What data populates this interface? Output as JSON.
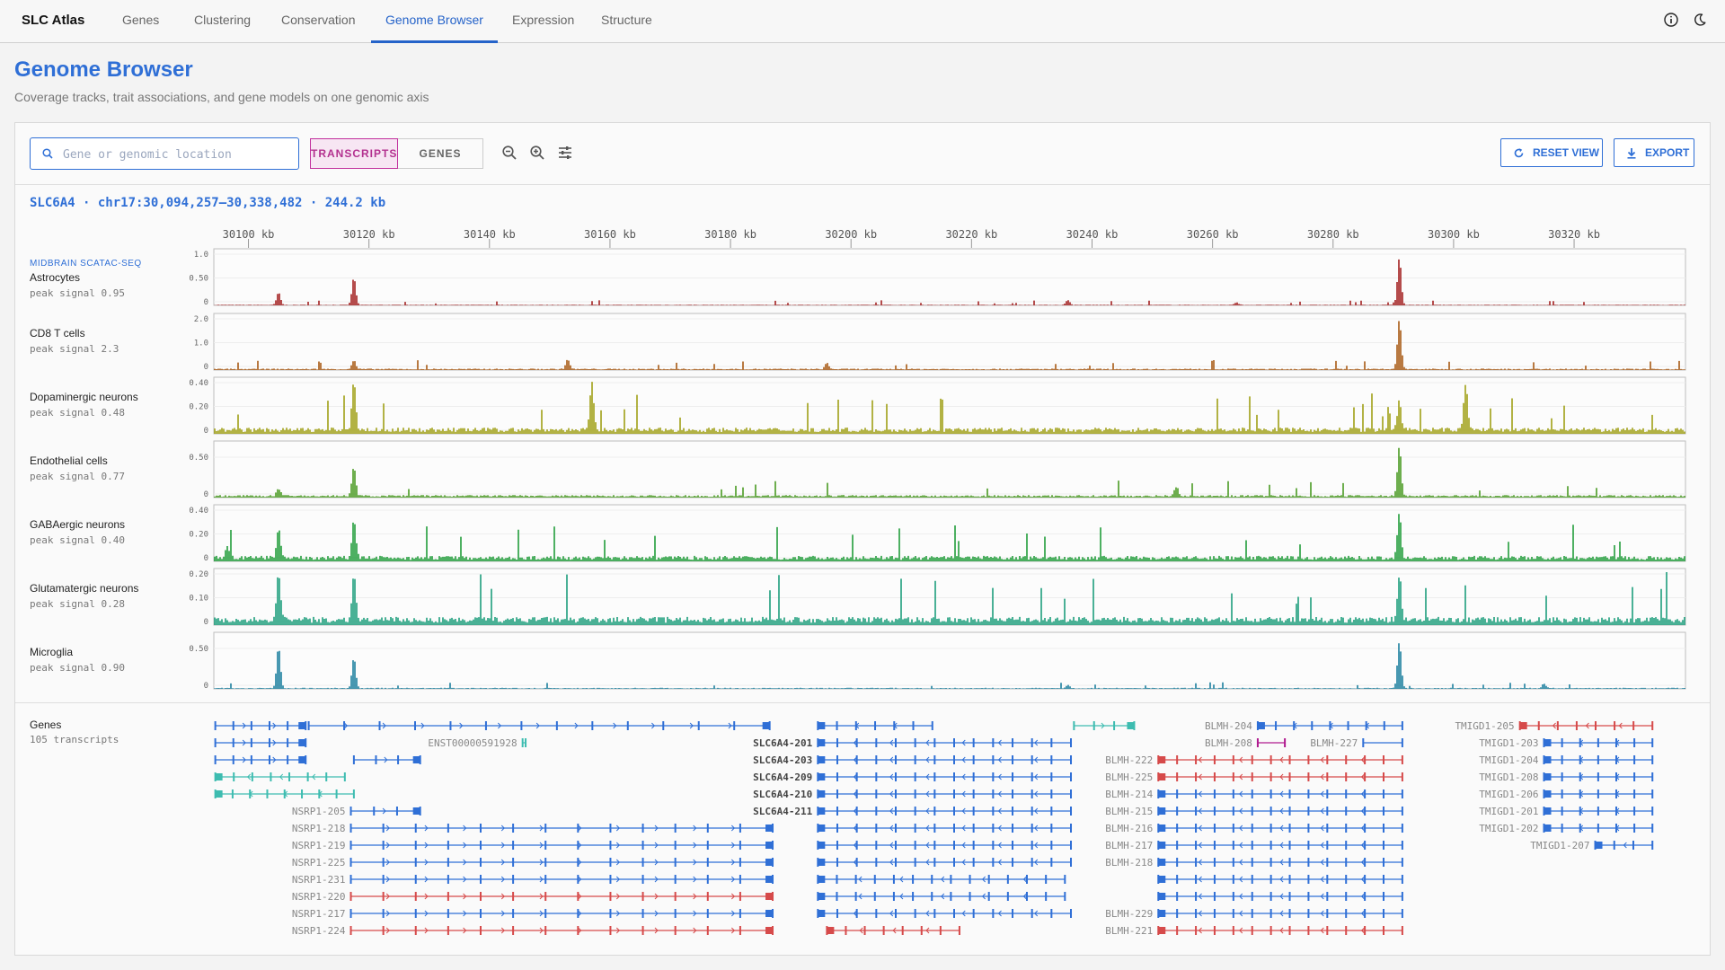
{
  "app": {
    "name": "SLC Atlas"
  },
  "nav": {
    "tabs": [
      {
        "label": "Genes",
        "active": false
      },
      {
        "label": "Clustering",
        "active": false
      },
      {
        "label": "Conservation",
        "active": false
      },
      {
        "label": "Genome Browser",
        "active": true
      },
      {
        "label": "Expression",
        "active": false
      },
      {
        "label": "Structure",
        "active": false
      }
    ],
    "icons": [
      "info-icon",
      "dark-mode-icon"
    ]
  },
  "page": {
    "title": "Genome Browser",
    "subtitle": "Coverage tracks, trait associations, and gene models on one genomic axis"
  },
  "toolbar": {
    "search_placeholder": "Gene or genomic location",
    "search_value": "",
    "mode_transcripts": "TRANSCRIPTS",
    "mode_genes": "GENES",
    "active_mode": "transcripts",
    "icons": [
      "zoom-out-icon",
      "zoom-in-icon",
      "track-settings-icon"
    ],
    "reset_label": "RESET VIEW",
    "export_label": "EXPORT"
  },
  "locus": {
    "text": "SLC6A4 · chr17:30,094,257–30,338,482 · 244.2 kb"
  },
  "axis": {
    "start_kb": 30094.257,
    "end_kb": 30338.482,
    "ticks": [
      {
        "kb": 30100,
        "label": "30100 kb"
      },
      {
        "kb": 30120,
        "label": "30120 kb"
      },
      {
        "kb": 30140,
        "label": "30140 kb"
      },
      {
        "kb": 30160,
        "label": "30160 kb"
      },
      {
        "kb": 30180,
        "label": "30180 kb"
      },
      {
        "kb": 30200,
        "label": "30200 kb"
      },
      {
        "kb": 30220,
        "label": "30220 kb"
      },
      {
        "kb": 30240,
        "label": "30240 kb"
      },
      {
        "kb": 30260,
        "label": "30260 kb"
      },
      {
        "kb": 30280,
        "label": "30280 kb"
      },
      {
        "kb": 30300,
        "label": "30300 kb"
      },
      {
        "kb": 30320,
        "label": "30320 kb"
      }
    ]
  },
  "tracks": {
    "group_label": "MIDBRAIN SCATAC-SEQ",
    "items": [
      {
        "name": "Astrocytes",
        "peak": "peak signal 0.95",
        "color": "#a32020",
        "ymax": 1.0,
        "ticks": [
          "1.0",
          "0.50",
          "0"
        ],
        "noise": 0.015,
        "peaks": [
          {
            "kb": 30105,
            "h": 0.25
          },
          {
            "kb": 30117.5,
            "h": 0.55
          },
          {
            "kb": 30291,
            "h": 0.95
          },
          {
            "kb": 30236,
            "h": 0.1
          },
          {
            "kb": 30264,
            "h": 0.05
          }
        ]
      },
      {
        "name": "CD8 T cells",
        "peak": "peak signal 2.3",
        "color": "#a85a14",
        "ymax": 2.0,
        "ticks": [
          "2.0",
          "1.0",
          "0"
        ],
        "noise": 0.06,
        "peaks": [
          {
            "kb": 30117.5,
            "h": 0.35
          },
          {
            "kb": 30291,
            "h": 2.0
          },
          {
            "kb": 30153,
            "h": 0.4
          },
          {
            "kb": 30196,
            "h": 0.25
          }
        ]
      },
      {
        "name": "Dopaminergic neurons",
        "peak": "peak signal 0.48",
        "color": "#a0a016",
        "ymax": 0.48,
        "ticks": [
          "0.40",
          "0.20",
          "0"
        ],
        "noise": 0.06,
        "peaks": [
          {
            "kb": 30117.5,
            "h": 0.48
          },
          {
            "kb": 30157,
            "h": 0.45
          },
          {
            "kb": 30291,
            "h": 0.3
          },
          {
            "kb": 30302,
            "h": 0.46
          }
        ]
      },
      {
        "name": "Endothelial cells",
        "peak": "peak signal 0.77",
        "color": "#4a9a23",
        "ymax": 0.77,
        "ticks": [
          "0.50",
          "0"
        ],
        "noise": 0.04,
        "peaks": [
          {
            "kb": 30117.5,
            "h": 0.45
          },
          {
            "kb": 30291,
            "h": 0.77
          },
          {
            "kb": 30105,
            "h": 0.12
          },
          {
            "kb": 30254,
            "h": 0.15
          }
        ]
      },
      {
        "name": "GABAergic neurons",
        "peak": "peak signal 0.40",
        "color": "#229d3b",
        "ymax": 0.45,
        "ticks": [
          "0.40",
          "0.20",
          "0"
        ],
        "noise": 0.05,
        "peaks": [
          {
            "kb": 30105,
            "h": 0.28
          },
          {
            "kb": 30117.5,
            "h": 0.35
          },
          {
            "kb": 30291,
            "h": 0.4
          },
          {
            "kb": 30096.5,
            "h": 0.12
          }
        ]
      },
      {
        "name": "Glutamatergic neurons",
        "peak": "peak signal 0.28",
        "color": "#1e9e7c",
        "ymax": 0.24,
        "ticks": [
          "0.20",
          "0.10",
          "0"
        ],
        "noise": 0.04,
        "peaks": [
          {
            "kb": 30105,
            "h": 0.22
          },
          {
            "kb": 30117.5,
            "h": 0.22
          },
          {
            "kb": 30291,
            "h": 0.22
          }
        ]
      },
      {
        "name": "Microglia",
        "peak": "peak signal 0.90",
        "color": "#1b7f9e",
        "ymax": 0.9,
        "ticks": [
          "0.50",
          "0"
        ],
        "noise": 0.02,
        "peaks": [
          {
            "kb": 30105,
            "h": 0.75
          },
          {
            "kb": 30117.5,
            "h": 0.55
          },
          {
            "kb": 30291,
            "h": 0.85
          },
          {
            "kb": 30236,
            "h": 0.06
          },
          {
            "kb": 30315,
            "h": 0.08
          }
        ]
      }
    ]
  },
  "genes": {
    "name": "Genes",
    "count": "105 transcripts",
    "colors": {
      "blue": "#2f6fd6",
      "red": "#d64a4a",
      "teal": "#3dbcb0",
      "magenta": "#b01a8f"
    },
    "transcripts": [
      {
        "label": "",
        "start": 30094.5,
        "end": 30109.5,
        "strand": "+",
        "color": "blue",
        "row": 0
      },
      {
        "label": "",
        "start": 30110,
        "end": 30186.5,
        "strand": "+",
        "color": "blue",
        "row": 0
      },
      {
        "label": "",
        "start": 30094.5,
        "end": 30109.5,
        "strand": "+",
        "color": "blue",
        "row": 1
      },
      {
        "label": "ENST00000591928",
        "start": 30145.5,
        "end": 30146,
        "strand": "+",
        "color": "teal",
        "row": 1
      },
      {
        "label": "",
        "start": 30094.5,
        "end": 30109.5,
        "strand": "+",
        "color": "blue",
        "row": 2
      },
      {
        "label": "",
        "start": 30117.5,
        "end": 30128.5,
        "strand": "+",
        "color": "blue",
        "row": 2
      },
      {
        "label": "",
        "start": 30094.5,
        "end": 30116,
        "strand": "-",
        "color": "teal",
        "row": 3
      },
      {
        "label": "",
        "start": 30094.5,
        "end": 30117.5,
        "strand": "-",
        "color": "teal",
        "row": 4
      },
      {
        "label": "NSRP1-205",
        "start": 30117,
        "end": 30128.5,
        "strand": "+",
        "color": "blue",
        "row": 5
      },
      {
        "label": "NSRP1-218",
        "start": 30117,
        "end": 30187,
        "strand": "+",
        "color": "blue",
        "row": 6
      },
      {
        "label": "NSRP1-219",
        "start": 30117,
        "end": 30187,
        "strand": "+",
        "color": "blue",
        "row": 7
      },
      {
        "label": "NSRP1-225",
        "start": 30117,
        "end": 30187,
        "strand": "+",
        "color": "blue",
        "row": 8
      },
      {
        "label": "NSRP1-231",
        "start": 30117,
        "end": 30187,
        "strand": "+",
        "color": "blue",
        "row": 9
      },
      {
        "label": "NSRP1-220",
        "start": 30117,
        "end": 30187,
        "strand": "+",
        "color": "red",
        "row": 10
      },
      {
        "label": "NSRP1-217",
        "start": 30117,
        "end": 30187,
        "strand": "+",
        "color": "blue",
        "row": 11
      },
      {
        "label": "NSRP1-224",
        "start": 30117,
        "end": 30187,
        "strand": "+",
        "color": "red",
        "row": 12
      },
      {
        "label": "SLC6A4-201",
        "start": 30194.5,
        "end": 30236.5,
        "strand": "-",
        "color": "blue",
        "row": 1
      },
      {
        "label": "SLC6A4-203",
        "start": 30194.5,
        "end": 30236.5,
        "strand": "-",
        "color": "blue",
        "row": 2
      },
      {
        "label": "SLC6A4-209",
        "start": 30194.5,
        "end": 30236.5,
        "strand": "-",
        "color": "blue",
        "row": 3
      },
      {
        "label": "SLC6A4-210",
        "start": 30194.5,
        "end": 30236.5,
        "strand": "-",
        "color": "blue",
        "row": 4
      },
      {
        "label": "SLC6A4-211",
        "start": 30194.5,
        "end": 30236.5,
        "strand": "-",
        "color": "blue",
        "row": 5
      },
      {
        "label": "",
        "start": 30194.5,
        "end": 30213.5,
        "strand": "-",
        "color": "blue",
        "row": 0
      },
      {
        "label": "",
        "start": 30237,
        "end": 30247,
        "strand": "+",
        "color": "teal",
        "row": 0
      },
      {
        "label": "",
        "start": 30194.5,
        "end": 30236.5,
        "strand": "-",
        "color": "blue",
        "row": 6
      },
      {
        "label": "",
        "start": 30194.5,
        "end": 30236.5,
        "strand": "-",
        "color": "blue",
        "row": 7
      },
      {
        "label": "",
        "start": 30194.5,
        "end": 30236.5,
        "strand": "-",
        "color": "blue",
        "row": 8
      },
      {
        "label": "",
        "start": 30194.5,
        "end": 30235.5,
        "strand": "-",
        "color": "blue",
        "row": 9
      },
      {
        "label": "",
        "start": 30194.5,
        "end": 30235.5,
        "strand": "-",
        "color": "blue",
        "row": 10
      },
      {
        "label": "",
        "start": 30194.5,
        "end": 30236.5,
        "strand": "-",
        "color": "blue",
        "row": 11
      },
      {
        "label": "",
        "start": 30196,
        "end": 30218,
        "strand": "-",
        "color": "red",
        "row": 12
      },
      {
        "label": "BLMH-204",
        "start": 30267.5,
        "end": 30291.5,
        "strand": "-",
        "color": "blue",
        "row": 0
      },
      {
        "label": "BLMH-208",
        "start": 30267.5,
        "end": 30272,
        "strand": "+",
        "color": "magenta",
        "row": 1
      },
      {
        "label": "BLMH-227",
        "start": 30285,
        "end": 30291.5,
        "strand": "-",
        "color": "blue",
        "row": 1
      },
      {
        "label": "BLMH-222",
        "start": 30251,
        "end": 30291.5,
        "strand": "-",
        "color": "red",
        "row": 2
      },
      {
        "label": "BLMH-225",
        "start": 30251,
        "end": 30291.5,
        "strand": "-",
        "color": "red",
        "row": 3
      },
      {
        "label": "BLMH-214",
        "start": 30251,
        "end": 30291.5,
        "strand": "-",
        "color": "blue",
        "row": 4
      },
      {
        "label": "BLMH-215",
        "start": 30251,
        "end": 30291.5,
        "strand": "-",
        "color": "blue",
        "row": 5
      },
      {
        "label": "BLMH-216",
        "start": 30251,
        "end": 30291.5,
        "strand": "-",
        "color": "blue",
        "row": 6
      },
      {
        "label": "BLMH-217",
        "start": 30251,
        "end": 30291.5,
        "strand": "-",
        "color": "blue",
        "row": 7
      },
      {
        "label": "BLMH-218",
        "start": 30251,
        "end": 30291.5,
        "strand": "-",
        "color": "blue",
        "row": 8
      },
      {
        "label": "",
        "start": 30251,
        "end": 30291.5,
        "strand": "-",
        "color": "blue",
        "row": 9
      },
      {
        "label": "",
        "start": 30251,
        "end": 30291.5,
        "strand": "-",
        "color": "blue",
        "row": 10
      },
      {
        "label": "BLMH-229",
        "start": 30251,
        "end": 30291.5,
        "strand": "-",
        "color": "blue",
        "row": 11
      },
      {
        "label": "BLMH-221",
        "start": 30251,
        "end": 30291.5,
        "strand": "-",
        "color": "red",
        "row": 12
      },
      {
        "label": "TMIGD1-205",
        "start": 30311,
        "end": 30333,
        "strand": "-",
        "color": "red",
        "row": 0
      },
      {
        "label": "TMIGD1-203",
        "start": 30315,
        "end": 30333,
        "strand": "-",
        "color": "blue",
        "row": 1
      },
      {
        "label": "TMIGD1-204",
        "start": 30315,
        "end": 30333,
        "strand": "-",
        "color": "blue",
        "row": 2
      },
      {
        "label": "TMIGD1-208",
        "start": 30315,
        "end": 30333,
        "strand": "-",
        "color": "blue",
        "row": 3
      },
      {
        "label": "TMIGD1-206",
        "start": 30315,
        "end": 30333,
        "strand": "-",
        "color": "blue",
        "row": 4
      },
      {
        "label": "TMIGD1-201",
        "start": 30315,
        "end": 30333,
        "strand": "-",
        "color": "blue",
        "row": 5
      },
      {
        "label": "TMIGD1-202",
        "start": 30315,
        "end": 30333,
        "strand": "-",
        "color": "blue",
        "row": 6
      },
      {
        "label": "TMIGD1-207",
        "start": 30323.5,
        "end": 30333,
        "strand": "-",
        "color": "blue",
        "row": 7
      }
    ]
  }
}
